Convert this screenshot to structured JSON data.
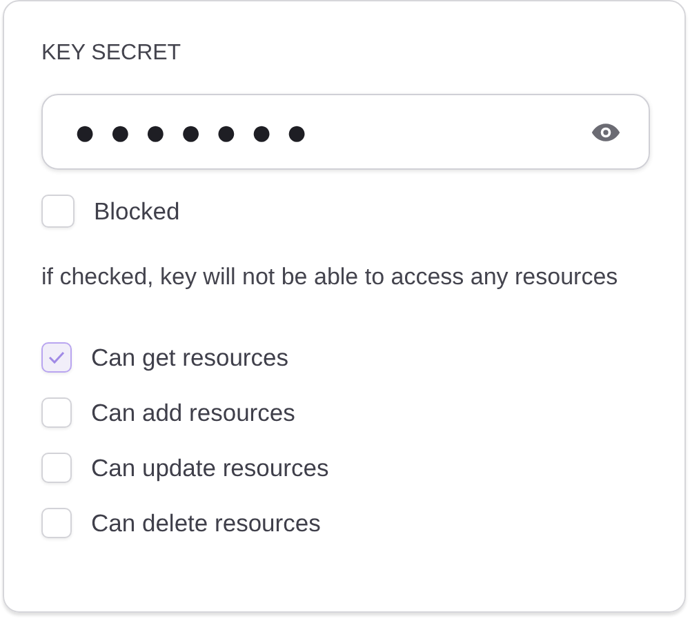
{
  "key_secret": {
    "label": "KEY SECRET",
    "value": "●●●●●●●"
  },
  "blocked": {
    "label": "Blocked",
    "checked": false
  },
  "help_text": "if checked, key will not be able to access any resources",
  "permissions": [
    {
      "label": "Can get resources",
      "checked": true
    },
    {
      "label": "Can add resources",
      "checked": false
    },
    {
      "label": "Can update resources",
      "checked": false
    },
    {
      "label": "Can delete resources",
      "checked": false
    }
  ]
}
